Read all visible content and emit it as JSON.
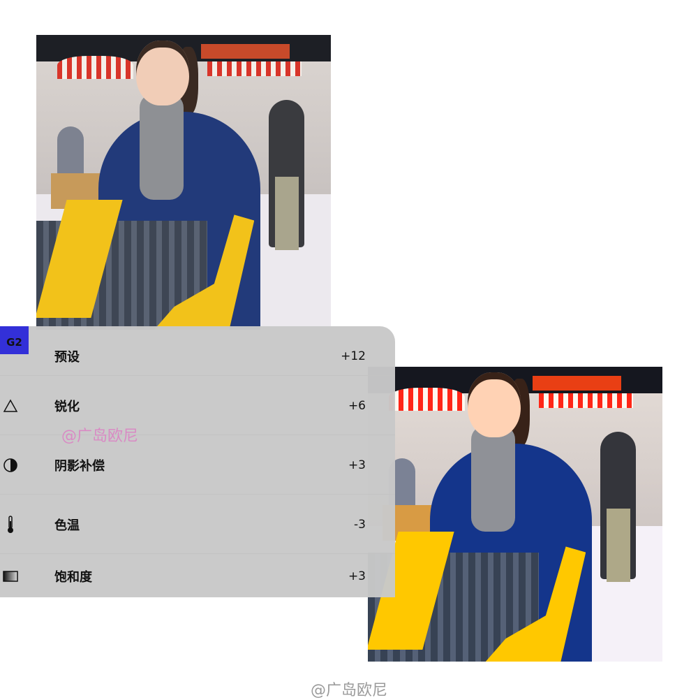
{
  "photos": {
    "before": {
      "description_icon": "photo"
    },
    "after": {
      "description_icon": "photo"
    }
  },
  "panel": {
    "preset_badge": "G2",
    "rows": [
      {
        "label": "预设",
        "value": "+12",
        "icon": "preset-badge"
      },
      {
        "label": "锐化",
        "value": "+6",
        "icon": "triangle-icon"
      },
      {
        "label": "阴影补偿",
        "value": "+3",
        "icon": "shadow-circle-icon"
      },
      {
        "label": "色温",
        "value": "-3",
        "icon": "thermometer-icon"
      },
      {
        "label": "饱和度",
        "value": "+3",
        "icon": "gradient-square-icon"
      }
    ]
  },
  "watermarks": {
    "middle": "@广岛欧尼",
    "bottom": "@广岛欧尼"
  },
  "colors": {
    "badge": "#3330d8",
    "panel": "#c8c8c8",
    "watermark": "#d98ac4"
  }
}
